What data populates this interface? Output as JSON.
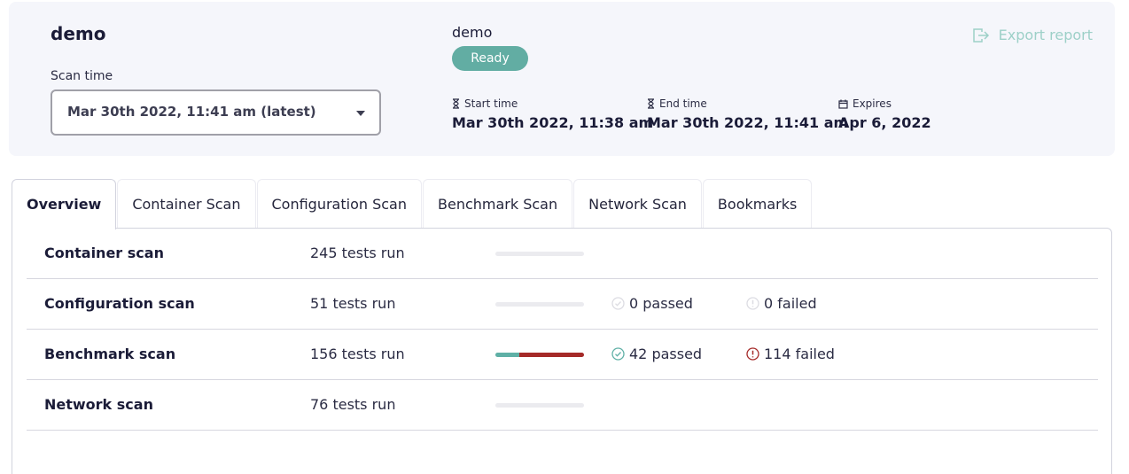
{
  "header": {
    "project_name": "demo",
    "scan_time_label": "Scan time",
    "scan_time_value": "Mar 30th 2022, 11:41 am (latest)",
    "cluster_name": "demo",
    "status": "Ready",
    "start_label": "Start time",
    "start_value": "Mar 30th 2022, 11:38 am",
    "end_label": "End time",
    "end_value": "Mar 30th 2022, 11:41 am",
    "expires_label": "Expires",
    "expires_value": "Apr 6, 2022",
    "export_label": "Export report",
    "icons": {
      "start": "hourglass-icon",
      "end": "hourglass-icon",
      "expires": "calendar-icon",
      "export": "export-icon",
      "dropdown": "caret-down-icon"
    }
  },
  "tabs": [
    {
      "label": "Overview",
      "active": true
    },
    {
      "label": "Container Scan",
      "active": false
    },
    {
      "label": "Configuration Scan",
      "active": false
    },
    {
      "label": "Benchmark Scan",
      "active": false
    },
    {
      "label": "Network Scan",
      "active": false
    },
    {
      "label": "Bookmarks",
      "active": false
    }
  ],
  "overview": {
    "rows": [
      {
        "name": "Container scan",
        "tests": "245 tests run"
      },
      {
        "name": "Configuration scan",
        "tests": "51 tests run",
        "passed": "0 passed",
        "failed": "0 failed",
        "pass_fraction": 0,
        "fail_fraction": 0
      },
      {
        "name": "Benchmark scan",
        "tests": "156 tests run",
        "passed": "42 passed",
        "failed": "114 failed",
        "pass_fraction": 0.27,
        "fail_fraction": 0.73
      },
      {
        "name": "Network scan",
        "tests": "76 tests run"
      }
    ]
  },
  "colors": {
    "accent": "#62ada3",
    "pass": "#5fb0a6",
    "fail": "#a52a28",
    "header_bg": "#f5f6fb",
    "export": "#9dd0c8"
  }
}
